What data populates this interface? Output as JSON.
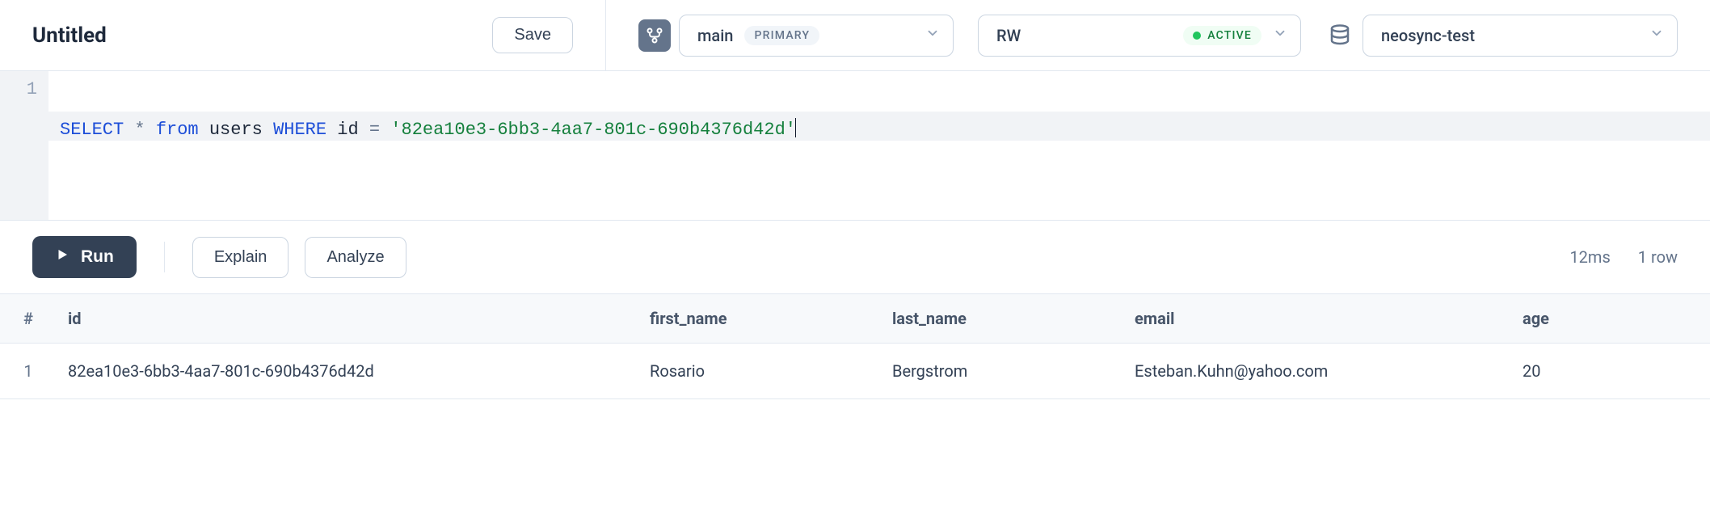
{
  "header": {
    "title": "Untitled",
    "save_label": "Save",
    "branch": {
      "name": "main",
      "badge": "PRIMARY"
    },
    "mode": {
      "name": "RW",
      "badge": "ACTIVE"
    },
    "database": {
      "name": "neosync-test"
    }
  },
  "editor": {
    "line_number": "1",
    "tokens": {
      "select": "SELECT",
      "star": "*",
      "from": "from",
      "table": "users",
      "where": "WHERE",
      "col": "id",
      "eq": "=",
      "str": "'82ea10e3-6bb3-4aa7-801c-690b4376d42d'"
    }
  },
  "actions": {
    "run": "Run",
    "explain": "Explain",
    "analyze": "Analyze",
    "timing": "12ms",
    "rowcount": "1 row"
  },
  "table": {
    "headers": {
      "idx": "#",
      "id": "id",
      "first_name": "first_name",
      "last_name": "last_name",
      "email": "email",
      "age": "age"
    },
    "rows": [
      {
        "idx": "1",
        "id": "82ea10e3-6bb3-4aa7-801c-690b4376d42d",
        "first_name": "Rosario",
        "last_name": "Bergstrom",
        "email": "Esteban.Kuhn@yahoo.com",
        "age": "20"
      }
    ]
  }
}
